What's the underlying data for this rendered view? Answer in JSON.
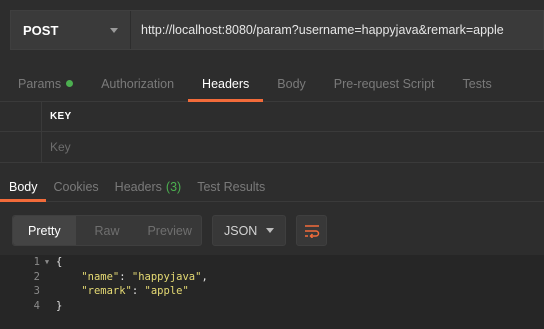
{
  "request": {
    "method": "POST",
    "url": "http://localhost:8080/param?username=happyjava&remark=apple"
  },
  "request_tabs": [
    {
      "label": "Params",
      "active": false,
      "has_dot": true
    },
    {
      "label": "Authorization",
      "active": false
    },
    {
      "label": "Headers",
      "active": true
    },
    {
      "label": "Body",
      "active": false
    },
    {
      "label": "Pre-request Script",
      "active": false
    },
    {
      "label": "Tests",
      "active": false
    }
  ],
  "headers_table": {
    "key_column": "KEY",
    "key_placeholder": "Key"
  },
  "response_tabs": {
    "body": "Body",
    "cookies": "Cookies",
    "headers": "Headers",
    "headers_count": "(3)",
    "test_results": "Test Results"
  },
  "view_modes": {
    "pretty": "Pretty",
    "raw": "Raw",
    "preview": "Preview"
  },
  "format": "JSON",
  "code_lines": [
    {
      "num": "1",
      "fold": true
    },
    {
      "num": "2",
      "fold": false
    },
    {
      "num": "3",
      "fold": false
    },
    {
      "num": "4",
      "fold": false
    }
  ],
  "code": {
    "open": "{",
    "key1": "\"name\"",
    "val1": "\"happyjava\"",
    "key2": "\"remark\"",
    "val2": "\"apple\"",
    "close": "}"
  },
  "colors": {
    "accent": "#f26b3a",
    "dot": "#4caf50",
    "string": "#e6db74"
  }
}
